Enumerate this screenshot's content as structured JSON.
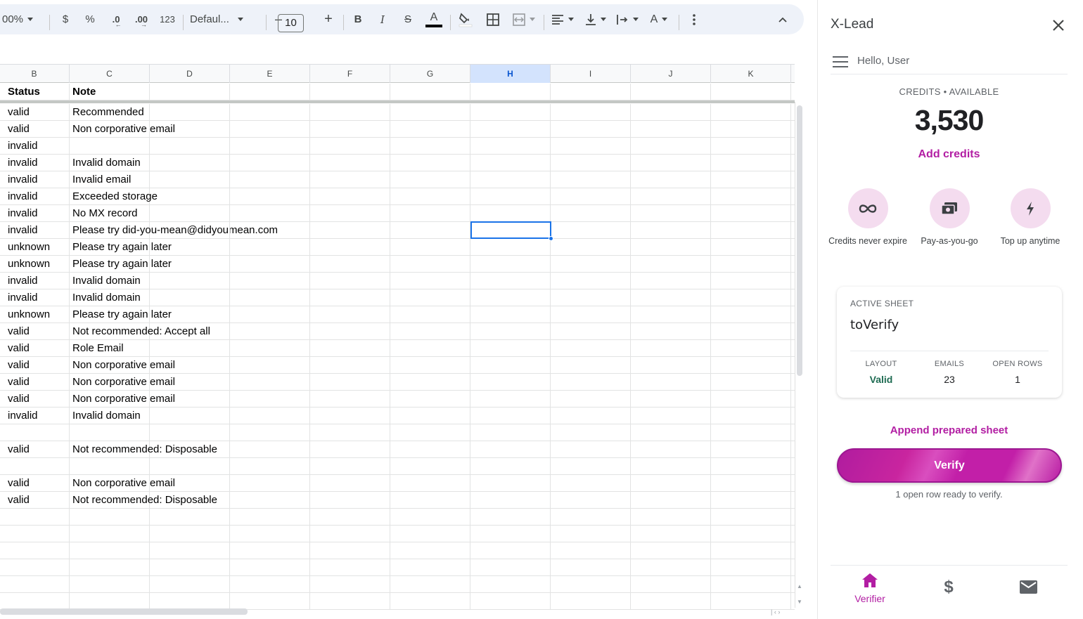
{
  "toolbar": {
    "zoom": "00%",
    "currency": "$",
    "percent": "%",
    "decrease_decimal": ".0",
    "increase_decimal": ".00",
    "number_format": "123",
    "font_name": "Defaul...",
    "font_size": "10",
    "minus": "–",
    "plus": "+"
  },
  "grid": {
    "columns": [
      {
        "label": "B",
        "selected": false
      },
      {
        "label": "C",
        "selected": false
      },
      {
        "label": "D",
        "selected": false
      },
      {
        "label": "E",
        "selected": false
      },
      {
        "label": "F",
        "selected": false
      },
      {
        "label": "G",
        "selected": false
      },
      {
        "label": "H",
        "selected": true
      },
      {
        "label": "I",
        "selected": false
      },
      {
        "label": "J",
        "selected": false
      },
      {
        "label": "K",
        "selected": false
      }
    ],
    "header": {
      "status": "Status",
      "note": "Note"
    },
    "rows": [
      {
        "status": "valid",
        "note": "Recommended"
      },
      {
        "status": "valid",
        "note": "Non corporative email"
      },
      {
        "status": "invalid",
        "note": ""
      },
      {
        "status": "invalid",
        "note": "Invalid domain"
      },
      {
        "status": "invalid",
        "note": "Invalid email"
      },
      {
        "status": "invalid",
        "note": "Exceeded storage"
      },
      {
        "status": "invalid",
        "note": "No MX record"
      },
      {
        "status": "invalid",
        "note": "Please try did-you-mean@didyoumean.com"
      },
      {
        "status": "unknown",
        "note": "Please try again later"
      },
      {
        "status": "unknown",
        "note": "Please try again later"
      },
      {
        "status": "invalid",
        "note": "Invalid domain"
      },
      {
        "status": "invalid",
        "note": "Invalid domain"
      },
      {
        "status": "unknown",
        "note": "Please try again later"
      },
      {
        "status": "valid",
        "note": "Not recommended: Accept all"
      },
      {
        "status": "valid",
        "note": "Role Email"
      },
      {
        "status": "valid",
        "note": "Non corporative email"
      },
      {
        "status": "valid",
        "note": "Non corporative email"
      },
      {
        "status": "valid",
        "note": "Non corporative email"
      },
      {
        "status": "invalid",
        "note": "Invalid domain"
      },
      {
        "status": "",
        "note": ""
      },
      {
        "status": "valid",
        "note": "Not recommended: Disposable"
      },
      {
        "status": "",
        "note": ""
      },
      {
        "status": "valid",
        "note": "Non corporative email"
      },
      {
        "status": "valid",
        "note": "Not recommended: Disposable"
      },
      {
        "status": "",
        "note": ""
      },
      {
        "status": "",
        "note": ""
      },
      {
        "status": "",
        "note": ""
      },
      {
        "status": "",
        "note": ""
      },
      {
        "status": "",
        "note": ""
      },
      {
        "status": "",
        "note": ""
      }
    ]
  },
  "panel": {
    "title": "X-Lead",
    "greeting": "Hello, User",
    "credits_label": "CREDITS • AVAILABLE",
    "credits_value": "3,530",
    "add_credits": "Add credits",
    "features": [
      {
        "icon": "infinity-icon",
        "label": "Credits never expire"
      },
      {
        "icon": "cash-icon",
        "label": "Pay-as-you-go"
      },
      {
        "icon": "bolt-icon",
        "label": "Top up anytime"
      }
    ],
    "active_sheet": {
      "label": "ACTIVE SHEET",
      "name": "toVerify",
      "stats": [
        {
          "label": "LAYOUT",
          "value": "Valid"
        },
        {
          "label": "EMAILS",
          "value": "23"
        },
        {
          "label": "OPEN ROWS",
          "value": "1"
        }
      ]
    },
    "append_link": "Append prepared sheet",
    "verify_button": "Verify",
    "verify_note": "1 open row ready to verify.",
    "nav": [
      {
        "icon": "home-icon",
        "label": "Verifier",
        "active": true
      },
      {
        "icon": "dollar-icon",
        "label": "",
        "active": false
      },
      {
        "icon": "mail-icon",
        "label": "",
        "active": false
      }
    ],
    "accent_color": "#b21ea3"
  }
}
